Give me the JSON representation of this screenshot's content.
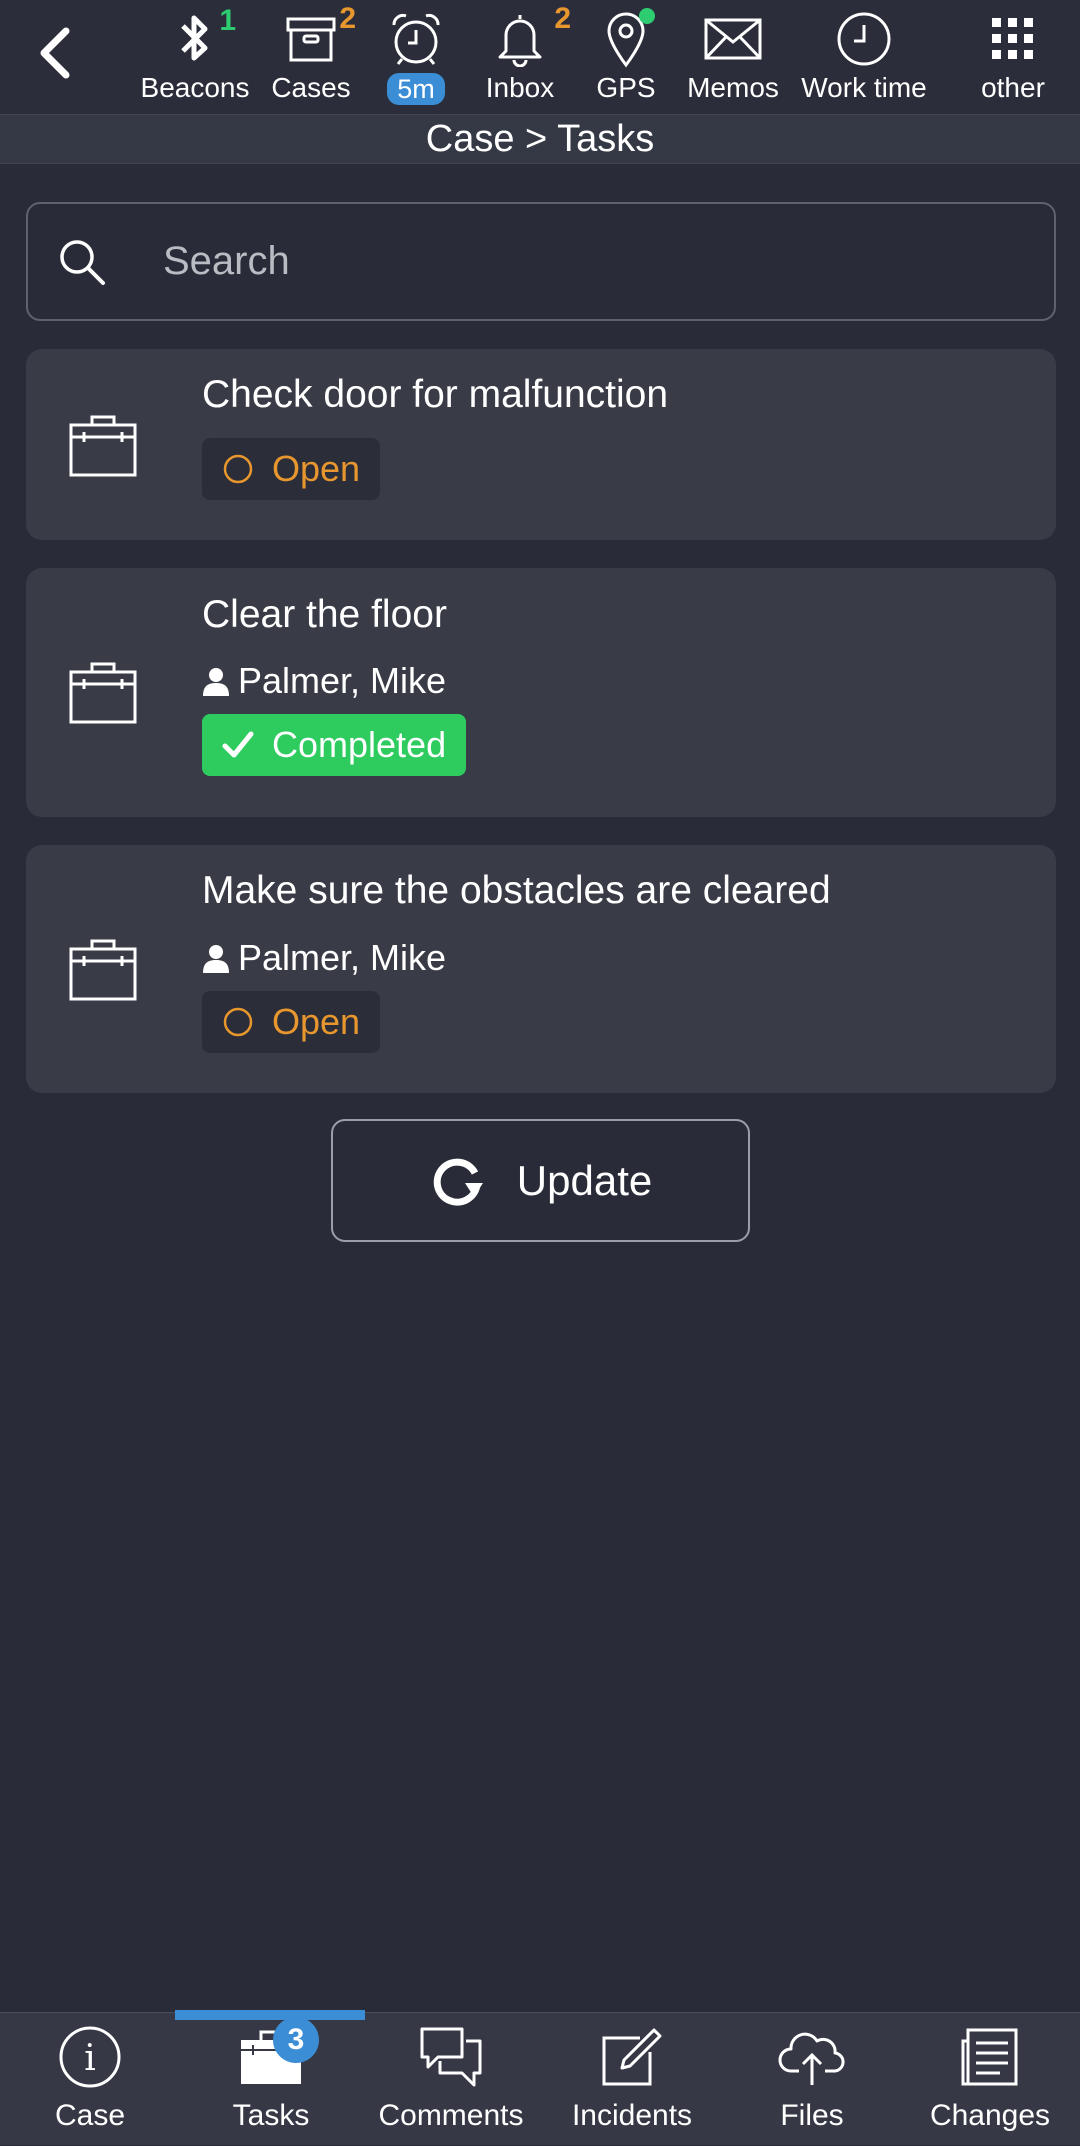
{
  "toolbar": {
    "items": [
      {
        "label": "Beacons",
        "icon": "bluetooth-icon",
        "badge": "1",
        "badge_color": "#2ecc71"
      },
      {
        "label": "Cases",
        "icon": "archive-box-icon",
        "badge": "2",
        "badge_color": "#e8962e"
      },
      {
        "label": "",
        "icon": "alarm-clock-icon",
        "pill": "5m"
      },
      {
        "label": "Inbox",
        "icon": "bell-icon",
        "badge": "2",
        "badge_color": "#e8962e"
      },
      {
        "label": "GPS",
        "icon": "location-pin-icon"
      },
      {
        "label": "Memos",
        "icon": "envelope-icon"
      },
      {
        "label": "Work time",
        "icon": "clock-icon"
      },
      {
        "label": "other",
        "icon": "grid-icon"
      }
    ]
  },
  "breadcrumb": "Case > Tasks",
  "search": {
    "placeholder": "Search",
    "value": ""
  },
  "tasks": [
    {
      "title": "Check door for malfunction",
      "assignee": "",
      "status": "Open"
    },
    {
      "title": "Clear the floor",
      "assignee": "Palmer, Mike",
      "status": "Completed"
    },
    {
      "title": "Make sure the obstacles are cleared",
      "assignee": "Palmer, Mike",
      "status": "Open"
    }
  ],
  "update_label": "Update",
  "bottom_nav": {
    "items": [
      {
        "label": "Case",
        "icon": "info-icon"
      },
      {
        "label": "Tasks",
        "icon": "briefcase-icon",
        "badge": "3",
        "active": true
      },
      {
        "label": "Comments",
        "icon": "comments-icon"
      },
      {
        "label": "Incidents",
        "icon": "edit-icon"
      },
      {
        "label": "Files",
        "icon": "cloud-upload-icon"
      },
      {
        "label": "Changes",
        "icon": "document-icon"
      }
    ]
  },
  "colors": {
    "background": "#292c38",
    "card": "#393c47",
    "accent": "#3b8ed6",
    "open": "#e8962e",
    "completed": "#2ecc5f"
  }
}
